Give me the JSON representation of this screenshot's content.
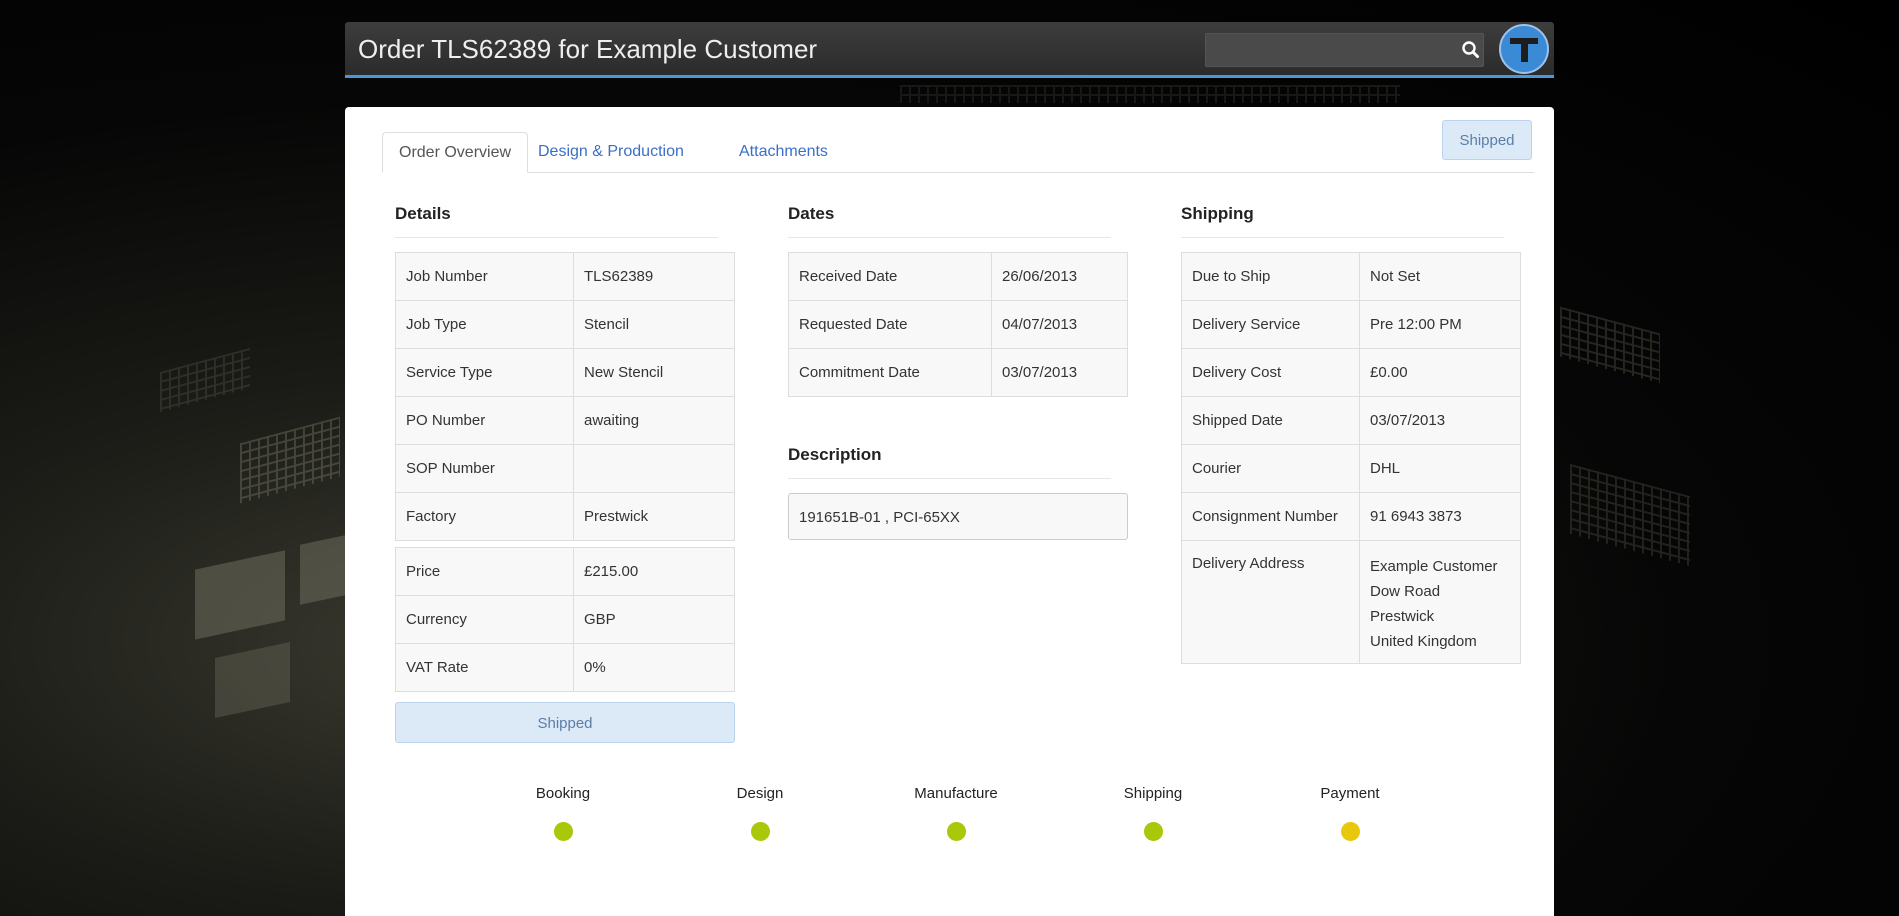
{
  "header": {
    "title": "Order TLS62389 for Example Customer",
    "search_placeholder": "",
    "search_icon": "search-icon",
    "logo_icon": "company-logo"
  },
  "tabs": [
    {
      "label": "Order Overview",
      "active": true
    },
    {
      "label": "Design & Production",
      "active": false
    },
    {
      "label": "Attachments",
      "active": false
    }
  ],
  "status_badge": "Shipped",
  "details": {
    "title": "Details",
    "rows": [
      {
        "label": "Job Number",
        "value": "TLS62389"
      },
      {
        "label": "Job Type",
        "value": "Stencil"
      },
      {
        "label": "Service Type",
        "value": "New Stencil"
      },
      {
        "label": "PO Number",
        "value": "awaiting"
      },
      {
        "label": "SOP Number",
        "value": ""
      },
      {
        "label": "Factory",
        "value": "Prestwick"
      }
    ],
    "pricing": [
      {
        "label": "Price",
        "value": "£215.00"
      },
      {
        "label": "Currency",
        "value": "GBP"
      },
      {
        "label": "VAT Rate",
        "value": "0%"
      }
    ],
    "status_button": "Shipped"
  },
  "dates": {
    "title": "Dates",
    "rows": [
      {
        "label": "Received Date",
        "value": "26/06/2013"
      },
      {
        "label": "Requested Date",
        "value": "04/07/2013"
      },
      {
        "label": "Commitment Date",
        "value": "03/07/2013"
      }
    ]
  },
  "description": {
    "title": "Description",
    "text": "191651B-01 , PCI-65XX"
  },
  "shipping": {
    "title": "Shipping",
    "rows": [
      {
        "label": "Due to Ship",
        "value": "Not Set"
      },
      {
        "label": "Delivery Service",
        "value": "Pre 12:00 PM"
      },
      {
        "label": "Delivery Cost",
        "value": "£0.00"
      },
      {
        "label": "Shipped Date",
        "value": "03/07/2013"
      },
      {
        "label": "Courier",
        "value": "DHL"
      },
      {
        "label": "Consignment Number",
        "value": "91 6943 3873"
      }
    ],
    "address_label": "Delivery Address",
    "address_lines": [
      "Example Customer",
      "Dow Road",
      "Prestwick",
      "United Kingdom"
    ]
  },
  "progress": {
    "steps": [
      {
        "label": "Booking",
        "color": "#aac70a"
      },
      {
        "label": "Design",
        "color": "#aac70a"
      },
      {
        "label": "Manufacture",
        "color": "#aac70a"
      },
      {
        "label": "Shipping",
        "color": "#aac70a"
      },
      {
        "label": "Payment",
        "color": "#e8c80c"
      }
    ]
  }
}
